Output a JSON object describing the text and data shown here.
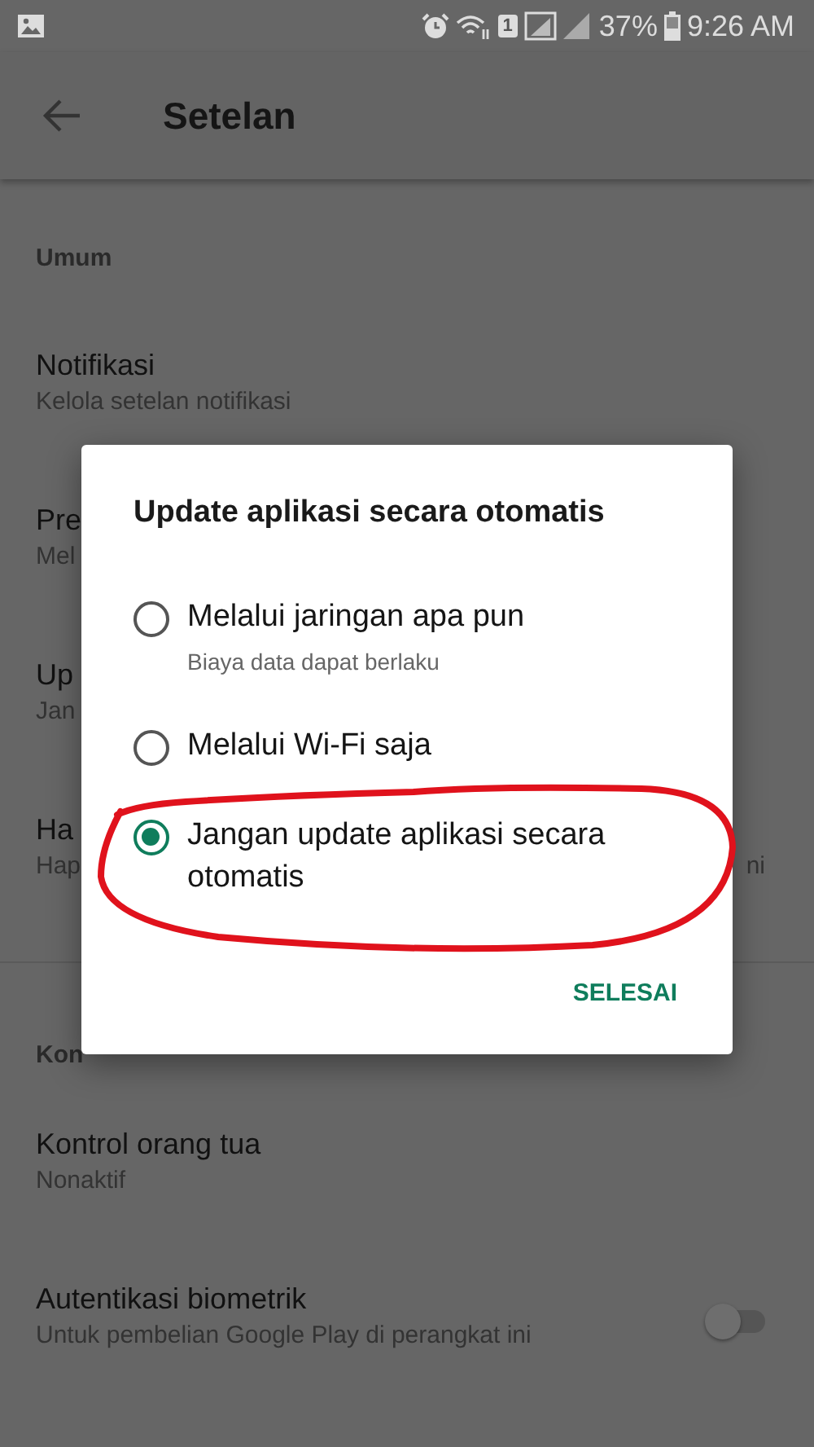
{
  "status_bar": {
    "sim_slot": "1",
    "battery": "37%",
    "time": "9:26 AM"
  },
  "app_bar": {
    "title": "Setelan"
  },
  "sections": [
    {
      "header": "Umum",
      "items": [
        {
          "kind": "text",
          "title": "Notifikasi",
          "subtitle": "Kelola setelan notifikasi"
        },
        {
          "kind": "text",
          "title": "Pre",
          "subtitle": "Mel"
        },
        {
          "kind": "text",
          "title": "Up",
          "subtitle": "Jan"
        },
        {
          "kind": "text",
          "title": "Ha",
          "subtitle": "Hap",
          "subtitle_end": "ni"
        }
      ]
    },
    {
      "header": "Kon",
      "items": [
        {
          "kind": "text",
          "title": "Kontrol orang tua",
          "subtitle": "Nonaktif"
        },
        {
          "kind": "switch",
          "title": "Autentikasi biometrik",
          "subtitle": "Untuk pembelian Google Play di perangkat ini",
          "on": false
        }
      ]
    }
  ],
  "dialog": {
    "title": "Update aplikasi secara otomatis",
    "options": [
      {
        "label": "Melalui jaringan apa pun",
        "detail": "Biaya data dapat berlaku",
        "selected": false
      },
      {
        "label": "Melalui Wi-Fi saja",
        "selected": false
      },
      {
        "label": "Jangan update aplikasi secara otomatis",
        "selected": true
      }
    ],
    "button": "SELESAI"
  }
}
